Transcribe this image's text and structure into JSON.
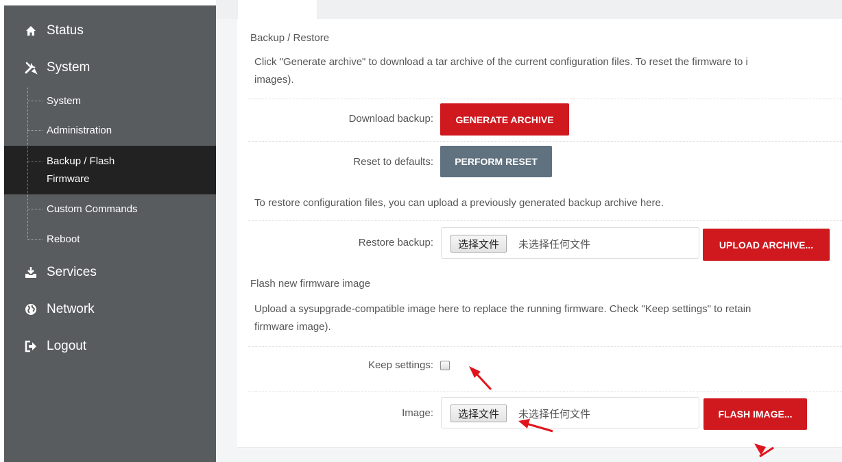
{
  "sidebar": {
    "items": [
      {
        "label": "Status",
        "icon": "home-icon"
      },
      {
        "label": "System",
        "icon": "tools-icon"
      },
      {
        "label": "Services",
        "icon": "download-tray-icon"
      },
      {
        "label": "Network",
        "icon": "globe-icon"
      },
      {
        "label": "Logout",
        "icon": "logout-icon"
      }
    ],
    "system_sub": [
      {
        "label": "System"
      },
      {
        "label": "Administration"
      },
      {
        "label_line1": "Backup / Flash",
        "label_line2": "Firmware",
        "active": true
      },
      {
        "label": "Custom Commands"
      },
      {
        "label": "Reboot"
      }
    ]
  },
  "backup": {
    "legend": "Backup / Restore",
    "desc_line1": "Click \"Generate archive\" to download a tar archive of the current configuration files. To reset the firmware to i",
    "desc_line2": "images).",
    "download_label": "Download backup:",
    "generate_button": "GENERATE ARCHIVE",
    "reset_label": "Reset to defaults:",
    "reset_button": "PERFORM RESET",
    "restore_desc": "To restore configuration files, you can upload a previously generated backup archive here.",
    "restore_label": "Restore backup:",
    "file_button": "选择文件",
    "file_text": "未选择任何文件",
    "upload_button": "UPLOAD ARCHIVE..."
  },
  "flash": {
    "legend": "Flash new firmware image",
    "desc_line1": "Upload a sysupgrade-compatible image here to replace the running firmware. Check \"Keep settings\" to retain",
    "desc_line2": "firmware image).",
    "keep_label": "Keep settings:",
    "keep_checked": false,
    "image_label": "Image:",
    "file_button": "选择文件",
    "file_text": "未选择任何文件",
    "flash_button": "FLASH IMAGE..."
  },
  "colors": {
    "sidebar_bg": "#595c5f",
    "sidebar_active": "#222222",
    "primary_red": "#d0191f",
    "gray_button": "#607180",
    "annotation_arrow": "#e0141c"
  }
}
